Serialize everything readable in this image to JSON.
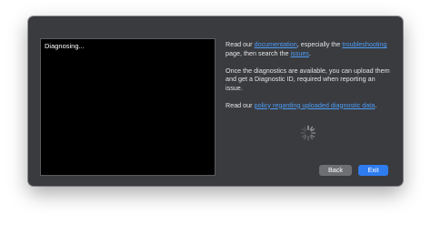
{
  "console": {
    "output": "Diagnosing..."
  },
  "info": {
    "p1_text1": "Read our ",
    "p1_link_documentation": "documentation",
    "p1_text2": ", especially the ",
    "p1_link_troubleshooting": "troubleshooting",
    "p1_text3": " page, then search the ",
    "p1_link_issues": "issues",
    "p1_text4": ".",
    "p2_text": "Once the diagnostics are available, you can upload them and get a Diagnostic ID, required when reporting an issue.",
    "p3_text1": "Read our ",
    "p3_link_policy": "policy regarding uploaded diagnostic data",
    "p3_text2": "."
  },
  "spinner": {
    "icon": "spinner-icon"
  },
  "buttons": {
    "back_label": "Back",
    "exit_label": "Exit"
  },
  "colors": {
    "window_bg": "#3a3b3f",
    "link": "#4d9df8",
    "primary_button": "#2e7cf0",
    "secondary_button": "#6e6f73"
  }
}
